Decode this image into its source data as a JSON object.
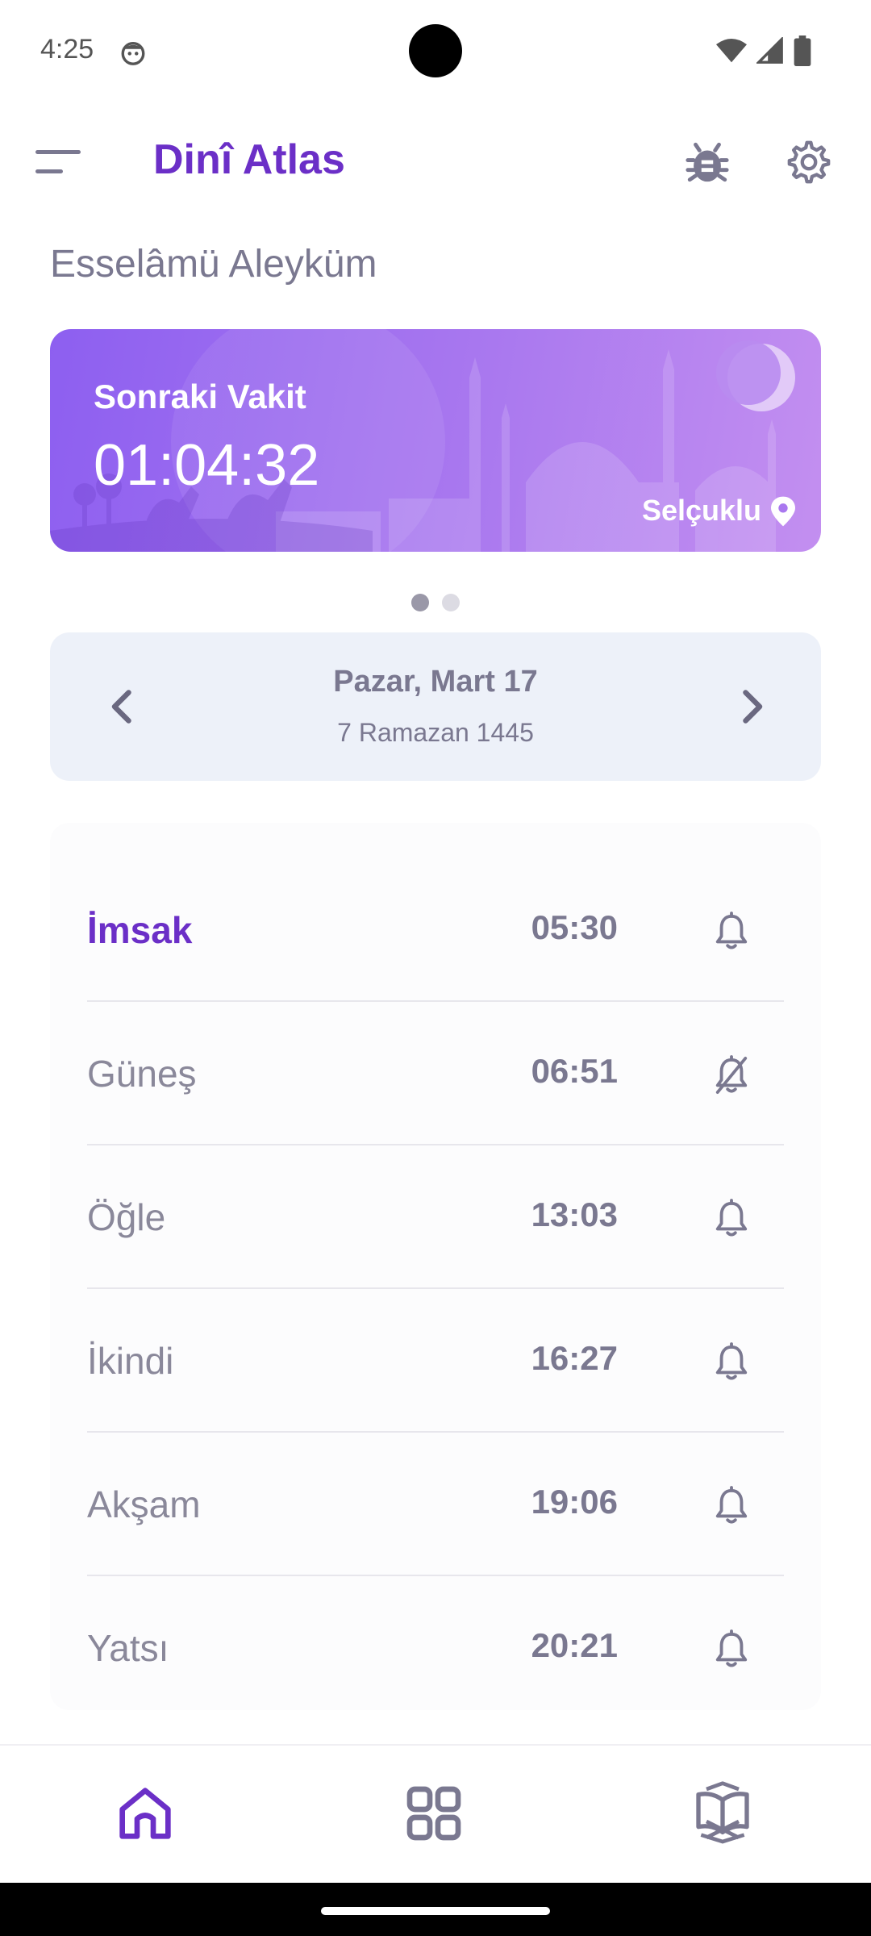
{
  "status_bar": {
    "time": "4:25"
  },
  "app_bar": {
    "title": "Dinî Atlas"
  },
  "greeting": "Esselâmü Aleyküm",
  "next_prayer_card": {
    "label": "Sonraki Vakit",
    "countdown": "01:04:32",
    "location": "Selçuklu"
  },
  "carousel": {
    "page": 1,
    "pages": 2
  },
  "date_nav": {
    "gregorian": "Pazar, Mart 17",
    "hijri": "7 Ramazan 1445"
  },
  "prayers": [
    {
      "name": "İmsak",
      "time": "05:30",
      "alarm": "on",
      "active": true
    },
    {
      "name": "Güneş",
      "time": "06:51",
      "alarm": "off",
      "active": false
    },
    {
      "name": "Öğle",
      "time": "13:03",
      "alarm": "on",
      "active": false
    },
    {
      "name": "İkindi",
      "time": "16:27",
      "alarm": "on",
      "active": false
    },
    {
      "name": "Akşam",
      "time": "19:06",
      "alarm": "on",
      "active": false
    },
    {
      "name": "Yatsı",
      "time": "20:21",
      "alarm": "on",
      "active": false
    }
  ],
  "bottom_nav": {
    "items": [
      {
        "icon": "home-icon",
        "selected": true
      },
      {
        "icon": "grid-icon",
        "selected": false
      },
      {
        "icon": "quran-book-icon",
        "selected": false
      }
    ]
  },
  "colors": {
    "brand": "#6b2fc7",
    "card_gradient_start": "#8d5ff0",
    "card_gradient_end": "#c38ff0",
    "date_box_bg": "#edf1f9",
    "text_muted": "#7a7890"
  }
}
